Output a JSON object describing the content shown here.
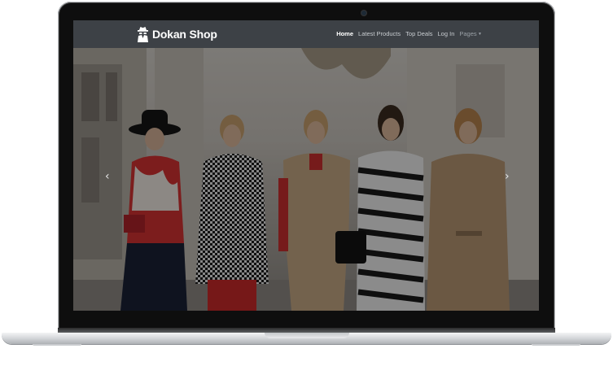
{
  "site": {
    "brand_name": "Dokan Shop",
    "brand_icon": "spy-icon"
  },
  "nav": {
    "items": [
      {
        "label": "Home",
        "active": true
      },
      {
        "label": "Latest Products",
        "active": false
      },
      {
        "label": "Top Deals",
        "active": false
      },
      {
        "label": "Log In",
        "active": false
      },
      {
        "label": "Pages",
        "active": false,
        "dropdown": true
      }
    ]
  },
  "hero": {
    "image_alt": "hero-image",
    "prev_icon": "chevron-left-icon",
    "next_icon": "chevron-right-icon",
    "prev_glyph": "‹",
    "next_glyph": "›"
  },
  "colors": {
    "navbar_bg": "#3d4146",
    "brand_text": "#ffffff",
    "nav_active": "#ffffff",
    "nav_text": "#c8ccd0"
  }
}
